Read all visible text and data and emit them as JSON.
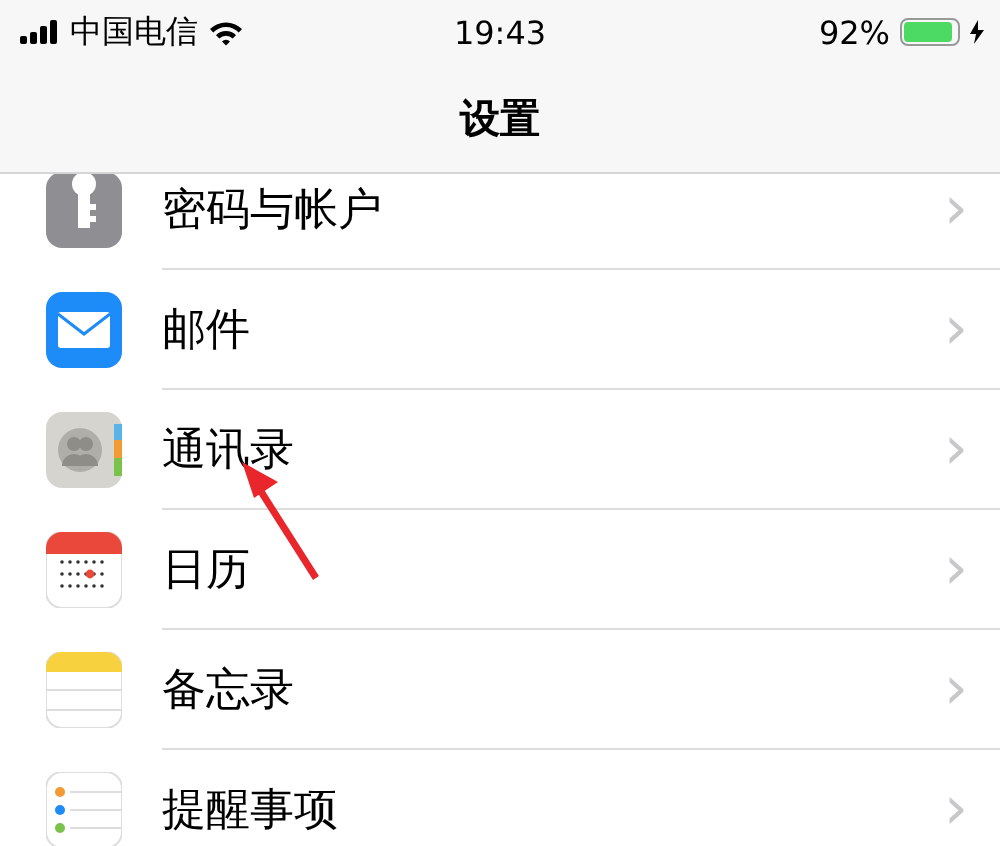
{
  "status_bar": {
    "carrier": "中国电信",
    "time": "19:43",
    "battery_text": "92%",
    "battery": {
      "level": 0.92,
      "charging": true
    }
  },
  "nav": {
    "title": "设置"
  },
  "rows": [
    {
      "kind": "key",
      "label": "密码与帐户",
      "chevron": "›"
    },
    {
      "kind": "mail",
      "label": "邮件",
      "chevron": "›"
    },
    {
      "kind": "contacts",
      "label": "通讯录",
      "chevron": "›"
    },
    {
      "kind": "calendar",
      "label": "日历",
      "chevron": "›"
    },
    {
      "kind": "notes",
      "label": "备忘录",
      "chevron": "›"
    },
    {
      "kind": "reminders",
      "label": "提醒事项",
      "chevron": "›"
    }
  ],
  "annotation": {
    "kind": "arrow"
  }
}
